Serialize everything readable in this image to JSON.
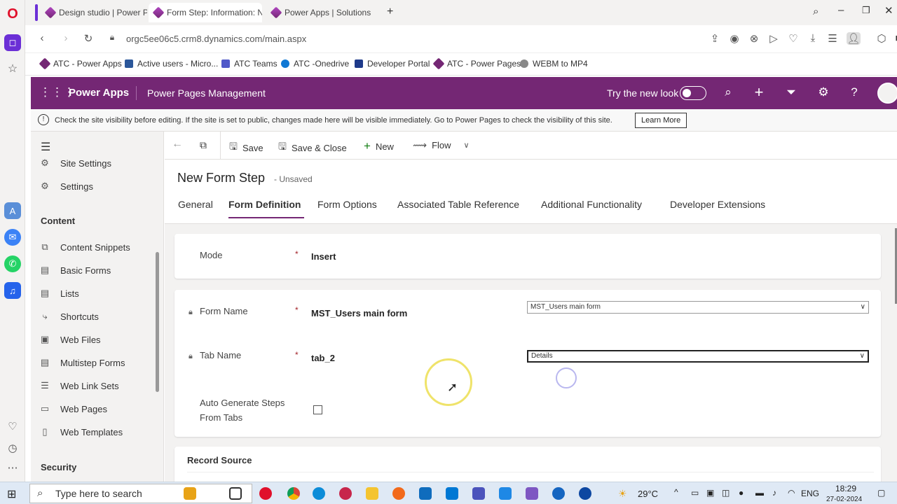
{
  "browser": {
    "tabs": [
      {
        "label": "Design studio | Power Pag"
      },
      {
        "label": "Form Step: Information: N"
      },
      {
        "label": "Power Apps | Solutions"
      }
    ],
    "url": "orgc5ee06c5.crm8.dynamics.com/main.aspx",
    "bookmarks": [
      {
        "label": "ATC - Power Apps"
      },
      {
        "label": "Active users - Micro..."
      },
      {
        "label": "ATC Teams"
      },
      {
        "label": "ATC -Onedrive"
      },
      {
        "label": "Developer Portal"
      },
      {
        "label": "ATC - Power Pages"
      },
      {
        "label": "WEBM to MP4"
      }
    ]
  },
  "header": {
    "app_name": "Power Apps",
    "module": "Power Pages Management",
    "try_new_look": "Try the new look"
  },
  "notice": {
    "text": "Check the site visibility before editing. If the site is set to public, changes made here will be visible immediately. Go to Power Pages to check the visibility of this site.",
    "button": "Learn More"
  },
  "sidebar": {
    "top_items": [
      {
        "label": "Site Settings"
      },
      {
        "label": "Settings"
      }
    ],
    "content_heading": "Content",
    "content_items": [
      {
        "label": "Content Snippets"
      },
      {
        "label": "Basic Forms"
      },
      {
        "label": "Lists"
      },
      {
        "label": "Shortcuts"
      },
      {
        "label": "Web Files"
      },
      {
        "label": "Multistep Forms"
      },
      {
        "label": "Web Link Sets"
      },
      {
        "label": "Web Pages"
      },
      {
        "label": "Web Templates"
      }
    ],
    "security_heading": "Security"
  },
  "commands": {
    "save": "Save",
    "save_close": "Save & Close",
    "new": "New",
    "flow": "Flow"
  },
  "form": {
    "title": "New Form Step",
    "status": "- Unsaved",
    "tabs": [
      {
        "label": "General"
      },
      {
        "label": "Form Definition"
      },
      {
        "label": "Form Options"
      },
      {
        "label": "Associated Table Reference"
      },
      {
        "label": "Additional Functionality"
      },
      {
        "label": "Developer Extensions"
      }
    ],
    "mode_label": "Mode",
    "mode_value": "Insert",
    "form_name_label": "Form Name",
    "form_name_value": "MST_Users main form",
    "form_name_select": "MST_Users main form",
    "tab_name_label": "Tab Name",
    "tab_name_value": "tab_2",
    "tab_name_select": "Details",
    "auto_generate_label_1": "Auto Generate Steps",
    "auto_generate_label_2": "From Tabs",
    "record_source": "Record Source",
    "required_mark": "*"
  },
  "taskbar": {
    "search_placeholder": "Type here to search",
    "weather": "29°C",
    "language": "ENG",
    "time": "18:29",
    "date": "27-02-2024"
  },
  "colors": {
    "brand": "#742774",
    "opera_red": "#e0102b"
  }
}
